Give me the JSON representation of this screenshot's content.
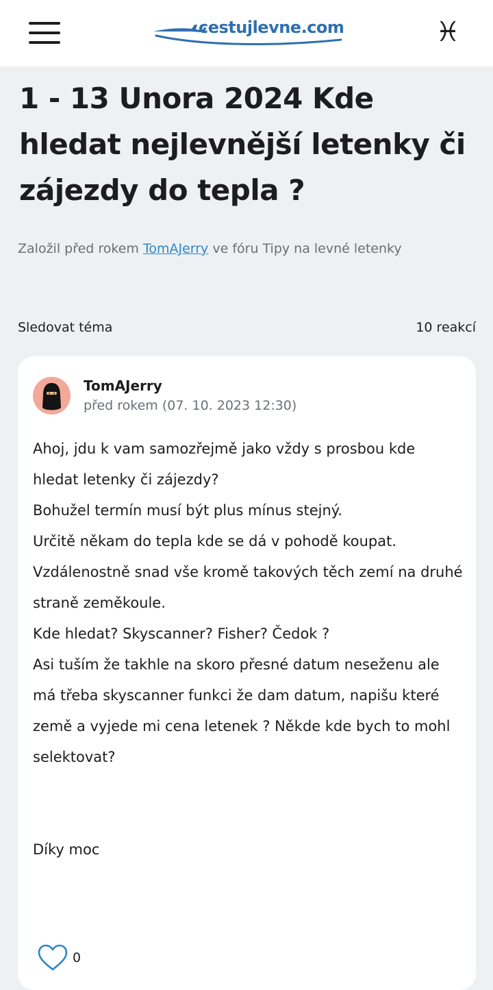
{
  "header": {
    "logo_text": "cestujlevne.com",
    "menu_icon": "hamburger-menu-icon",
    "profile_icon": "pisces-icon",
    "profile_glyph": "♓"
  },
  "thread": {
    "title": "1 - 13 Unora 2024 Kde hledat nejlevnější letenky či zájezdy do tepla ?",
    "meta_prefix": "Založil před rokem",
    "meta_author": "TomAJerry",
    "meta_suffix": "ve fóru Tipy na levné letenky",
    "follow_label": "Sledovat téma",
    "reactions_label": "10 reakcí"
  },
  "post": {
    "author": "TomAJerry",
    "date": "před rokem (07. 10. 2023 12:30)",
    "lines": [
      "Ahoj, jdu k vam samozřejmě jako vždy s prosbou kde hledat letenky či zájezdy?",
      "Bohužel termín musí být plus mínus stejný.",
      "Určitě někam do tepla kde se dá v pohodě koupat.",
      "Vzdálenostně snad vše kromě takových těch zemí na druhé straně zeměkoule.",
      "Kde hledat? Skyscanner? Fisher? Čedok ?",
      "Asi tuším že takhle na skoro přesné datum neseženu ale má třeba skyscanner funkci že dam datum, napišu které země a vyjede mi cena letenek ? Někde kde bych to mohl selektovat?"
    ],
    "closing": "Díky moc",
    "like_count": "0"
  },
  "colors": {
    "page_bg": "#edf1f4",
    "brand": "#2f6fb0",
    "link": "#2f86c8",
    "avatar_bg": "#f2a99a"
  }
}
